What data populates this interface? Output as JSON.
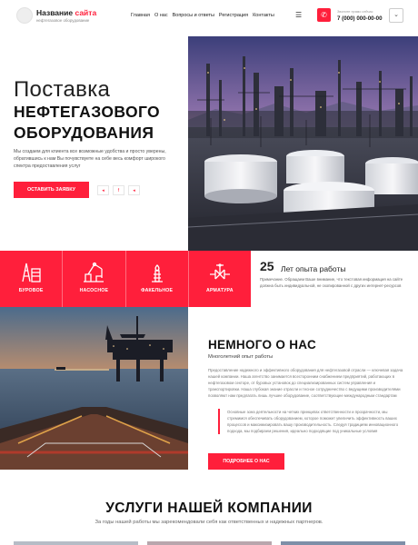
{
  "header": {
    "site_title_main": "Название",
    "site_title_accent": "сайта",
    "site_subtitle": "нефтегазовое оборудование",
    "nav": [
      "Главная",
      "О нас",
      "Вопросы и ответы",
      "Регистрация",
      "Контакты"
    ],
    "phone_caption": "Звоните прямо сейчас",
    "phone_number": "7 (000) 000-00-00"
  },
  "hero": {
    "title_line1": "Поставка",
    "title_line2": "НЕФТЕГАЗОВОГО",
    "title_line3": "ОБОРУДОВАНИЯ",
    "description": "Мы создаем для клиента все возможные удобства и просто уверены, обратившись к нам Вы почувствуете на себе весь комфорт широкого спектра предоставления услуг",
    "cta_label": "Оставить заявку",
    "social_icons": [
      "vk-icon",
      "facebook-icon",
      "instagram-icon"
    ]
  },
  "categories": [
    {
      "label": "БУРОВОЕ",
      "icon": "drilling-rig-icon"
    },
    {
      "label": "НАСОСНОЕ",
      "icon": "pump-icon"
    },
    {
      "label": "ФАКЕЛЬНОЕ",
      "icon": "flare-stack-icon"
    },
    {
      "label": "АРМАТУРА",
      "icon": "valve-icon"
    }
  ],
  "experience": {
    "number": "25",
    "label": "Лет опыта работы",
    "text": "Примечание. Обращаем Ваше внимание, что текстовая информация на сайте должна быть индивидуальной, не скопированной с других интернет-ресурсов"
  },
  "about": {
    "title": "НЕМНОГО О НАС",
    "subtitle": "Многолетний опыт работы",
    "paragraph": "Предоставление надежного и эффективного оборудования для нефтегазовой отрасли — ключевая задача нашей компании. Наша агентство занимается всесторонним снабжением предприятий, работающих в нефтегазовом секторе, от буровых установок до специализированных систем управления и транспортировки. Наша глубокая знание отрасли и тесное сотрудничество с ведущими производителями позволяют нам предлагать лишь лучшее оборудование, соответствующее международным стандартам",
    "quote": "Основные зона деятельности на четких принципах ответственности и прозрачности, мы стремимся обеспечивать оборудованием, которое поможет увеличить эффективность ваших процессов и максимизировать вашу производительность. Следуя традициям инновационного подхода, мы подбираем решения, идеально подходящие под уникальные условия",
    "button_label": "Подробнее о нас"
  },
  "services": {
    "title": "УСЛУГИ НАШЕЙ КОМПАНИИ",
    "subtitle": "За годы нашей работы мы зарекомендовали себя как ответственных и надежных партнеров."
  },
  "colors": {
    "accent": "#ff1f3b",
    "text": "#222222",
    "muted": "#777777"
  }
}
